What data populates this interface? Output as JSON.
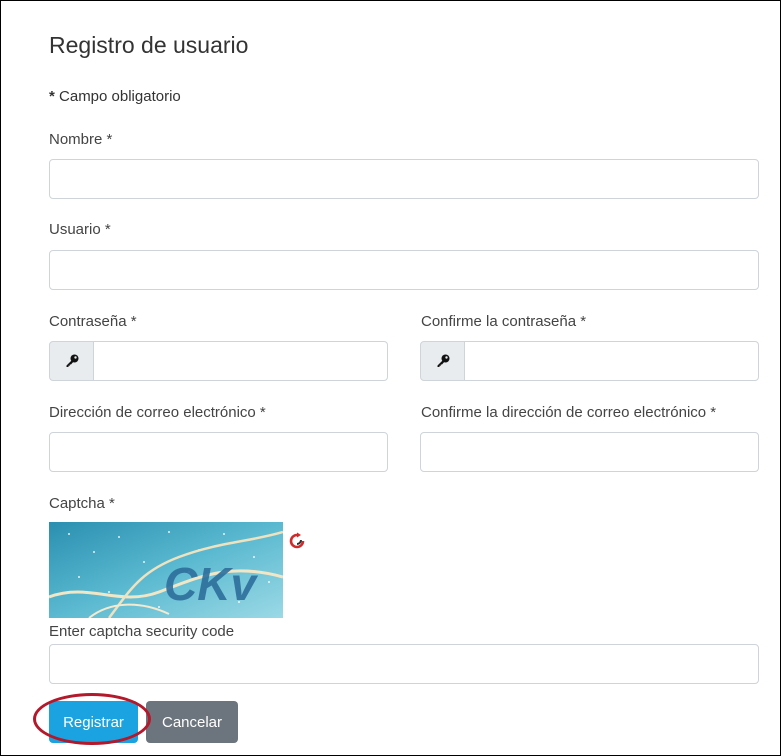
{
  "page": {
    "title": "Registro de usuario",
    "required_mark": "*",
    "required_note": "Campo obligatorio"
  },
  "fields": {
    "nombre": {
      "label": "Nombre *",
      "value": ""
    },
    "usuario": {
      "label": "Usuario *",
      "value": ""
    },
    "password": {
      "label": "Contraseña *",
      "value": "",
      "icon": "key-icon"
    },
    "password_confirm": {
      "label": "Confirme la contraseña *",
      "value": "",
      "icon": "key-icon"
    },
    "email": {
      "label": "Dirección de correo electrónico *",
      "value": ""
    },
    "email_confirm": {
      "label": "Confirme la dirección de correo electrónico *",
      "value": ""
    },
    "captcha": {
      "label": "Captcha *",
      "image_text": "CKv",
      "refresh_icon": "refresh-icon",
      "code_label": "Enter captcha security code",
      "value": ""
    }
  },
  "buttons": {
    "register": "Registrar",
    "cancel": "Cancelar"
  },
  "colors": {
    "primary": "#1aa3e0",
    "secondary": "#6c757d",
    "highlight": "#b3182b"
  }
}
